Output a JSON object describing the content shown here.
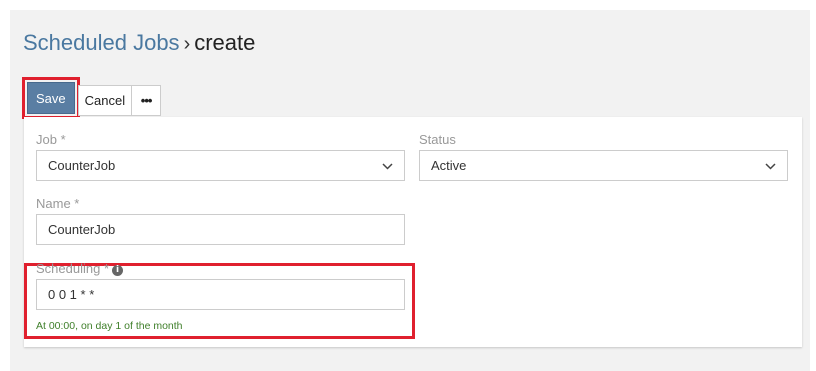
{
  "breadcrumb": {
    "parent": "Scheduled Jobs",
    "separator": "›",
    "current": "create"
  },
  "toolbar": {
    "save_label": "Save",
    "cancel_label": "Cancel",
    "more_label": "•••"
  },
  "form": {
    "job": {
      "label": "Job *",
      "value": "CounterJob"
    },
    "status": {
      "label": "Status",
      "value": "Active"
    },
    "name": {
      "label": "Name *",
      "value": "CounterJob"
    },
    "scheduling": {
      "label": "Scheduling *",
      "info_icon": "i",
      "value": "0 0 1 * *",
      "hint": "At 00:00, on day 1 of the month"
    }
  },
  "colors": {
    "link": "#4a78a0",
    "primary_button": "#5a7ea3",
    "highlight": "#e0202e",
    "hint_text": "#3f7f2a"
  },
  "icons": {
    "select_chevron": "chevron-down-icon",
    "info": "info-icon",
    "more": "more-horizontal-icon"
  }
}
